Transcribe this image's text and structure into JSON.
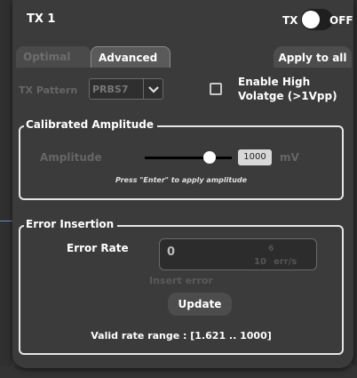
{
  "panel": {
    "title": "TX 1",
    "tx_label": "TX",
    "toggle_state": "OFF"
  },
  "tabs": [
    {
      "label": "Optimal",
      "active": false
    },
    {
      "label": "Advanced",
      "active": true
    }
  ],
  "apply_all_label": "Apply to all",
  "tx_pattern": {
    "label": "TX Pattern",
    "value": "PRBS7",
    "chevron_icon": "chevron-down-icon"
  },
  "enable_high_voltage": {
    "label": "Enable High Volatge (>1Vpp)",
    "checked": false
  },
  "calibrated_amplitude": {
    "title": "Calibrated Amplitude",
    "label": "Amplitude",
    "value": "1000",
    "unit": "mV",
    "slider_level": 0.8,
    "hint": "Press \"Enter\" to apply amplitude"
  },
  "error_insertion": {
    "title": "Error Insertion",
    "rate_label": "Error Rate",
    "rate_value": "0",
    "rate_units_base": "10",
    "rate_units_exp": "6",
    "rate_units_suffix": "err/s",
    "insert_label": "Insert error",
    "update_label": "Update",
    "range_text": "Valid rate range : [1.621 .. 1000]"
  },
  "colors": {
    "panel_bg": "#3b3b3b",
    "border": "#e6e6e6",
    "disabled_text": "#666666"
  }
}
